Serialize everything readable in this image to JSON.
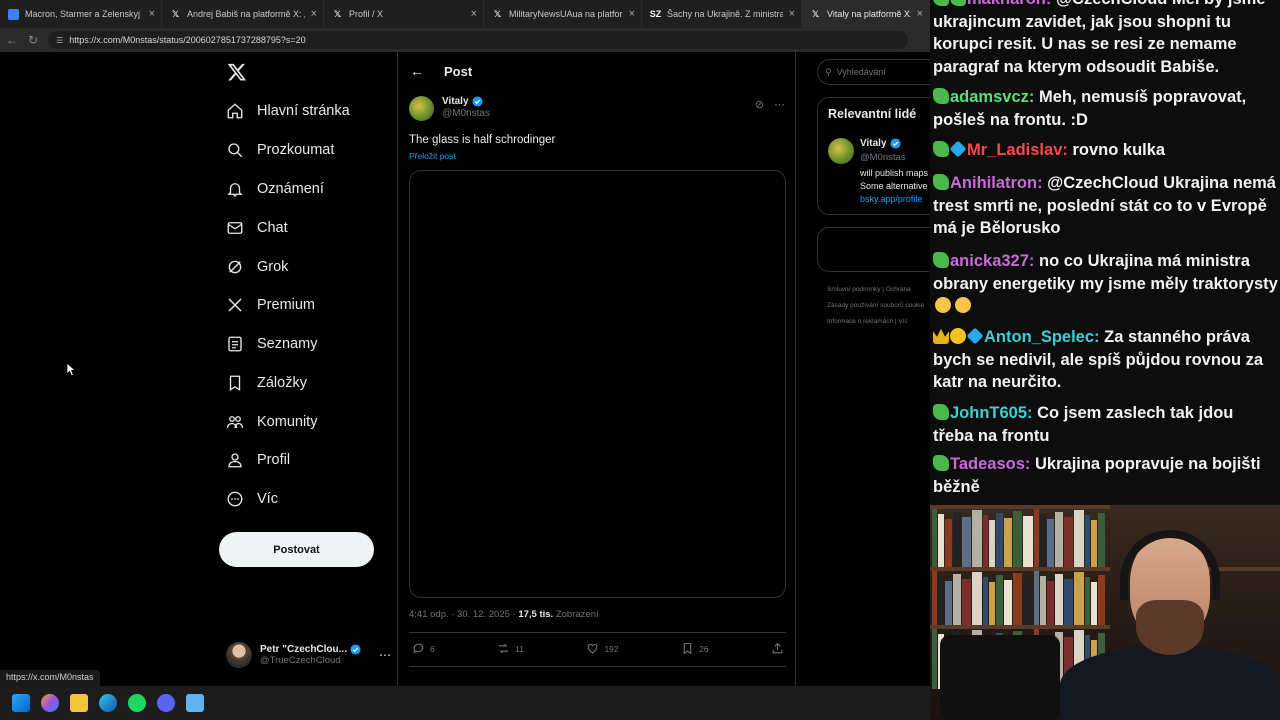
{
  "browser": {
    "tabs": [
      {
        "icon": "news-icon",
        "label": "Macron, Starmer a Zelenskyj pode",
        "active": false
      },
      {
        "icon": "x-icon",
        "label": "Andrej Babiš na platformě X: „Dne",
        "active": false
      },
      {
        "icon": "x-icon",
        "label": "Profil / X",
        "active": false
      },
      {
        "icon": "x-icon",
        "label": "MilitaryNewsUAua na platformě",
        "active": false
      },
      {
        "icon": "sz-icon",
        "label": "Šachy na Ukrajině. Z ministra obra",
        "active": false
      },
      {
        "icon": "x-icon",
        "label": "Vitaly na platformě X: „The gl",
        "active": true
      }
    ],
    "url": "https://x.com/M0nstas/status/2006027851737288795?s=20",
    "status_url": "https://x.com/M0nstas"
  },
  "sidebar": {
    "items": [
      {
        "icon": "home-icon",
        "label": "Hlavní stránka"
      },
      {
        "icon": "search-icon",
        "label": "Prozkoumat"
      },
      {
        "icon": "bell-icon",
        "label": "Oznámení"
      },
      {
        "icon": "mail-icon",
        "label": "Chat"
      },
      {
        "icon": "grok-icon",
        "label": "Grok"
      },
      {
        "icon": "x-icon",
        "label": "Premium"
      },
      {
        "icon": "list-icon",
        "label": "Seznamy"
      },
      {
        "icon": "bookmark-icon",
        "label": "Záložky"
      },
      {
        "icon": "communities-icon",
        "label": "Komunity"
      },
      {
        "icon": "person-icon",
        "label": "Profil"
      },
      {
        "icon": "more-icon",
        "label": "Víc"
      }
    ],
    "post_button": "Postovat",
    "account": {
      "name": "Petr \"CzechClou...",
      "handle": "@TrueCzechCloud"
    }
  },
  "main": {
    "header_title": "Post",
    "tweet": {
      "author_name": "Vitaly",
      "author_handle": "@M0nstas",
      "text": "The glass is half schrodinger",
      "translate_label": "Přeložit post",
      "time": "4:41 odp. · 30. 12. 2025 · ",
      "views_count": "17,5 tis.",
      "views_label": " Zobrazení",
      "replies": "6",
      "reposts": "11",
      "likes": "192",
      "bookmarks": "26"
    }
  },
  "right": {
    "search_placeholder": "Vyhledávání",
    "relevant_title": "Relevantní lidé",
    "person": {
      "name": "Vitaly",
      "handle": "@M0nstas",
      "bio_line1": "will publish maps",
      "bio_line2": "Some alternative",
      "link": "bsky.app/profile"
    },
    "footer": [
      "Smluvní podmínky  |  Ochrana",
      "Zásady používání souborů cookie",
      "Informace o reklamách  |  Víc"
    ]
  },
  "chat": {
    "messages": [
      {
        "badges": [
          "green",
          "green"
        ],
        "user": "makharon",
        "user_color": "#c86bd8",
        "text": "@CzechCloud Mel by jsme ukrajincum zavidet, jak jsou shopni tu korupci resit. U nas se resi ze nemame paragraf na kterym odsoudit Babiše."
      },
      {
        "badges": [
          "green"
        ],
        "user": "adamsvcz",
        "user_color": "#58e07a",
        "text": "Meh, nemusíš popravovat, pošleš na frontu. :D"
      },
      {
        "badges": [
          "green",
          "cube"
        ],
        "user": "Mr_Ladislav",
        "user_color": "#ff4a4a",
        "text": "rovno kulka"
      },
      {
        "badges": [
          "green"
        ],
        "user": "Anihilatron",
        "user_color": "#c86bd8",
        "text": "@CzechCloud Ukrajina nemá trest smrti ne, poslední stát co to v Evropě má je Bělorusko"
      },
      {
        "badges": [
          "green"
        ],
        "user": "anicka327",
        "user_color": "#c86bd8",
        "text": "no co Ukrajina má ministra obrany energetiky my jsme měly traktorysty"
      },
      {
        "badges": [
          "crown",
          "coin",
          "cube"
        ],
        "user": "Anton_Spelec",
        "user_color": "#3ecfd6",
        "text": "Za stanného práva bych se nedivil, ale spíš půjdou rovnou za katr na neurčito."
      },
      {
        "badges": [
          "green"
        ],
        "user": "JohnT605",
        "user_color": "#3ecfd6",
        "text": "Co jsem zaslech tak jdou třeba na frontu"
      },
      {
        "badges": [
          "green"
        ],
        "user": "Tadeasos",
        "user_color": "#c86bd8",
        "text": "Ukrajina popravuje na bojišti běžně"
      }
    ]
  },
  "colors": {
    "accent": "#1d9bf0",
    "border": "#2f3336",
    "muted": "#71767b"
  }
}
